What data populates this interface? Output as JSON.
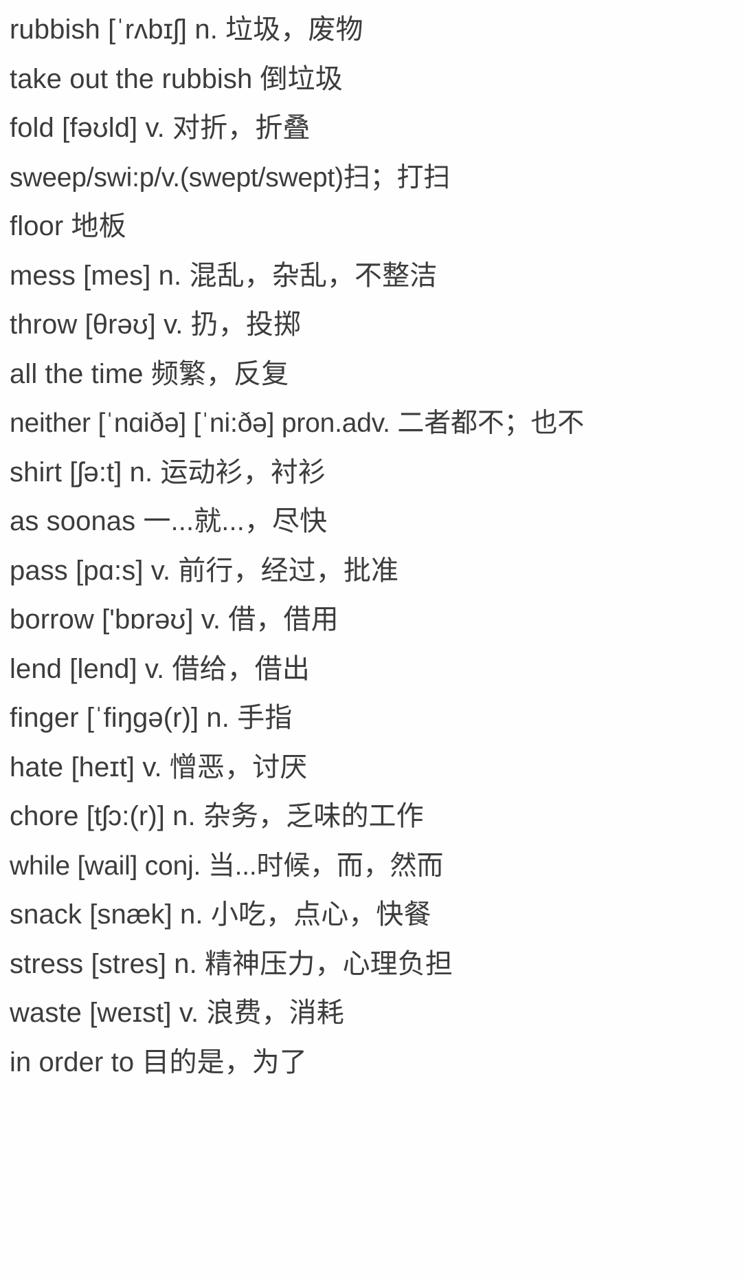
{
  "page": {
    "background_color": "#fefefe",
    "text_color": "#3c3c3c",
    "title": "English-Chinese vocabulary list"
  },
  "vocab_list": [
    {
      "line": "rubbish  [ˈrʌbɪʃ] n. 垃圾，废物"
    },
    {
      "line": "take out the rubbish  倒垃圾"
    },
    {
      "line": "fold  [fəʊld] v. 对折，折叠"
    },
    {
      "line": "sweep/swi:p/v.(swept/swept)扫；打扫"
    },
    {
      "line": "floor  地板"
    },
    {
      "line": "mess  [mes] n. 混乱，杂乱，不整洁"
    },
    {
      "line": "throw  [θrəʊ] v. 扔，投掷"
    },
    {
      "line": "all the time  频繁，反复"
    },
    {
      "line": "neither [ˈnɑiðə] [ˈni:ðə] pron.adv. 二者都不；也不"
    },
    {
      "line": "shirt  [ʃə:t] n. 运动衫，衬衫"
    },
    {
      "line": "as soonas  一...就...，尽快"
    },
    {
      "line": "pass  [pɑ:s] v. 前行，经过，批准"
    },
    {
      "line": "borrow  ['bɒrəʊ] v. 借，借用"
    },
    {
      "line": "lend  [lend] v. 借给，借出"
    },
    {
      "line": "finger  [ˈfiŋgə(r)] n. 手指"
    },
    {
      "line": "hate  [heɪt] v. 憎恶，讨厌"
    },
    {
      "line": "chore  [tʃɔ:(r)] n. 杂务，乏味的工作"
    },
    {
      "line": "while  [wail] conj. 当...时候，而，然而"
    },
    {
      "line": "snack  [snæk] n. 小吃，点心，快餐"
    },
    {
      "line": "stress  [stres] n. 精神压力，心理负担"
    },
    {
      "line": "waste  [weɪst] v. 浪费，消耗"
    },
    {
      "line": "in order to  目的是，为了"
    }
  ]
}
